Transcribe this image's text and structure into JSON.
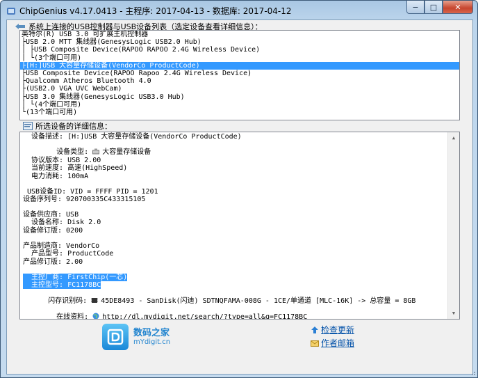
{
  "window": {
    "title": "ChipGenius v4.17.0413 - 主程序: 2017-04-13 - 数据库: 2017-04-12",
    "buttons": {
      "minimize": "−",
      "maximize": "□",
      "close": "✕"
    }
  },
  "device_list": {
    "header": "系统上连接的USB控制器与USB设备列表（选定设备查看详细信息）：",
    "items": [
      {
        "text": "英特尔(R) USB 3.0 可扩展主机控制器",
        "selected": false
      },
      {
        "text": "├USB 2.0 MTT 集线器(GenesysLogic USB2.0 Hub)",
        "selected": false
      },
      {
        "text": "│ ├USB Composite Device(RAPOO RAPOO 2.4G Wireless Device)",
        "selected": false
      },
      {
        "text": "│ └(3个端口可用)",
        "selected": false
      },
      {
        "text": "├[H:]USB 大容量存储设备(VendorCo ProductCode)",
        "selected": true
      },
      {
        "text": "├USB Composite Device(RAPOO Rapoo 2.4G Wireless Device)",
        "selected": false
      },
      {
        "text": "├Qualcomm Atheros Bluetooth 4.0",
        "selected": false
      },
      {
        "text": "├(USB2.0 VGA UVC WebCam)",
        "selected": false
      },
      {
        "text": "├USB 3.0 集线器(GenesysLogic USB3.0 Hub)",
        "selected": false
      },
      {
        "text": "│ └(4个端口可用)",
        "selected": false
      },
      {
        "text": "└(13个端口可用)",
        "selected": false
      }
    ]
  },
  "details": {
    "header": "所选设备的详细信息：",
    "lines": {
      "desc": "  设备描述: [H:]USB 大容量存储设备(VendorCo ProductCode)",
      "type_label": "  设备类型: ",
      "type_value": "大容量存储设备",
      "protocol": "  协议版本: USB 2.00",
      "speed": "  当前速度: 高速(HighSpeed)",
      "power": "  电力消耗: 100mA",
      "usbid": " USB设备ID: VID = FFFF PID = 1201",
      "serial": "设备序列号: 920700335C433315105",
      "vendor": "设备供应商: USB",
      "devname": "  设备名称: Disk 2.0",
      "devrev": "设备修订版: 0200",
      "maker": "产品制造商: VendorCo",
      "model": "  产品型号: ProductCode",
      "prodrev": "产品修订版: 2.00",
      "ctrl_vendor": "  主控厂商: FirstChip(一芯)",
      "ctrl_model": "  主控型号: FC1178BC",
      "flash_label": "闪存识别码: ",
      "flash_value": "45DE8493 - SanDisk(闪迪) SDTNQFAMA-008G - 1CE/单通道 [MLC-16K] -> 总容量 = 8GB",
      "online_label": "  在线资料: ",
      "online_value": "http://dl.mydigit.net/search/?type=all&q=FC1178BC"
    }
  },
  "footer": {
    "logo_cn": "数码之家",
    "logo_en": "mYdigit.cn",
    "check_update": "检查更新",
    "author_email": "作者邮箱"
  },
  "colors": {
    "selection": "#3399ff",
    "link": "#0050a8",
    "brand": "#2385cf"
  }
}
